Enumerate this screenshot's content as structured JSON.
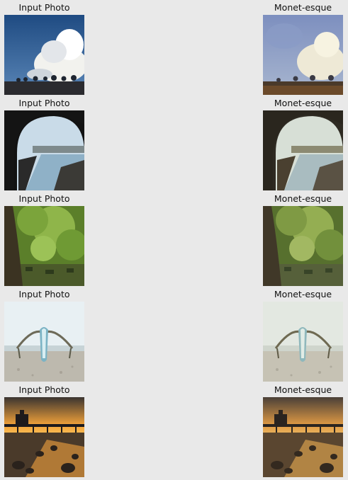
{
  "figure": {
    "rows": [
      {
        "input_caption": "Input Photo",
        "output_caption": "Monet-esque",
        "scene": "cloud-sky-treeline",
        "palette": {
          "sky": "#2e5d93",
          "cloud": "#f2f2ee",
          "ground": "#2c2c2e"
        }
      },
      {
        "input_caption": "Input Photo",
        "output_caption": "Monet-esque",
        "scene": "tunnel-arch-canal",
        "palette": {
          "sky": "#c9dbe8",
          "arch": "#141414",
          "water": "#8fb1c7"
        }
      },
      {
        "input_caption": "Input Photo",
        "output_caption": "Monet-esque",
        "scene": "forest-tree-trunk",
        "palette": {
          "foliage": "#6e9a33",
          "trunk": "#3b3322",
          "ground": "#4b5a2a"
        }
      },
      {
        "input_caption": "Input Photo",
        "output_caption": "Monet-esque",
        "scene": "outrigger-boat-beach",
        "palette": {
          "sky": "#eaf1f3",
          "sand": "#bdb9ae",
          "boat": "#7bb3c4"
        }
      },
      {
        "input_caption": "Input Photo",
        "output_caption": "Monet-esque",
        "scene": "sunset-pier-rocks",
        "palette": {
          "sky": "#f3a33a",
          "pier": "#1d1a1c",
          "shore": "#4a3a2a"
        }
      }
    ]
  }
}
